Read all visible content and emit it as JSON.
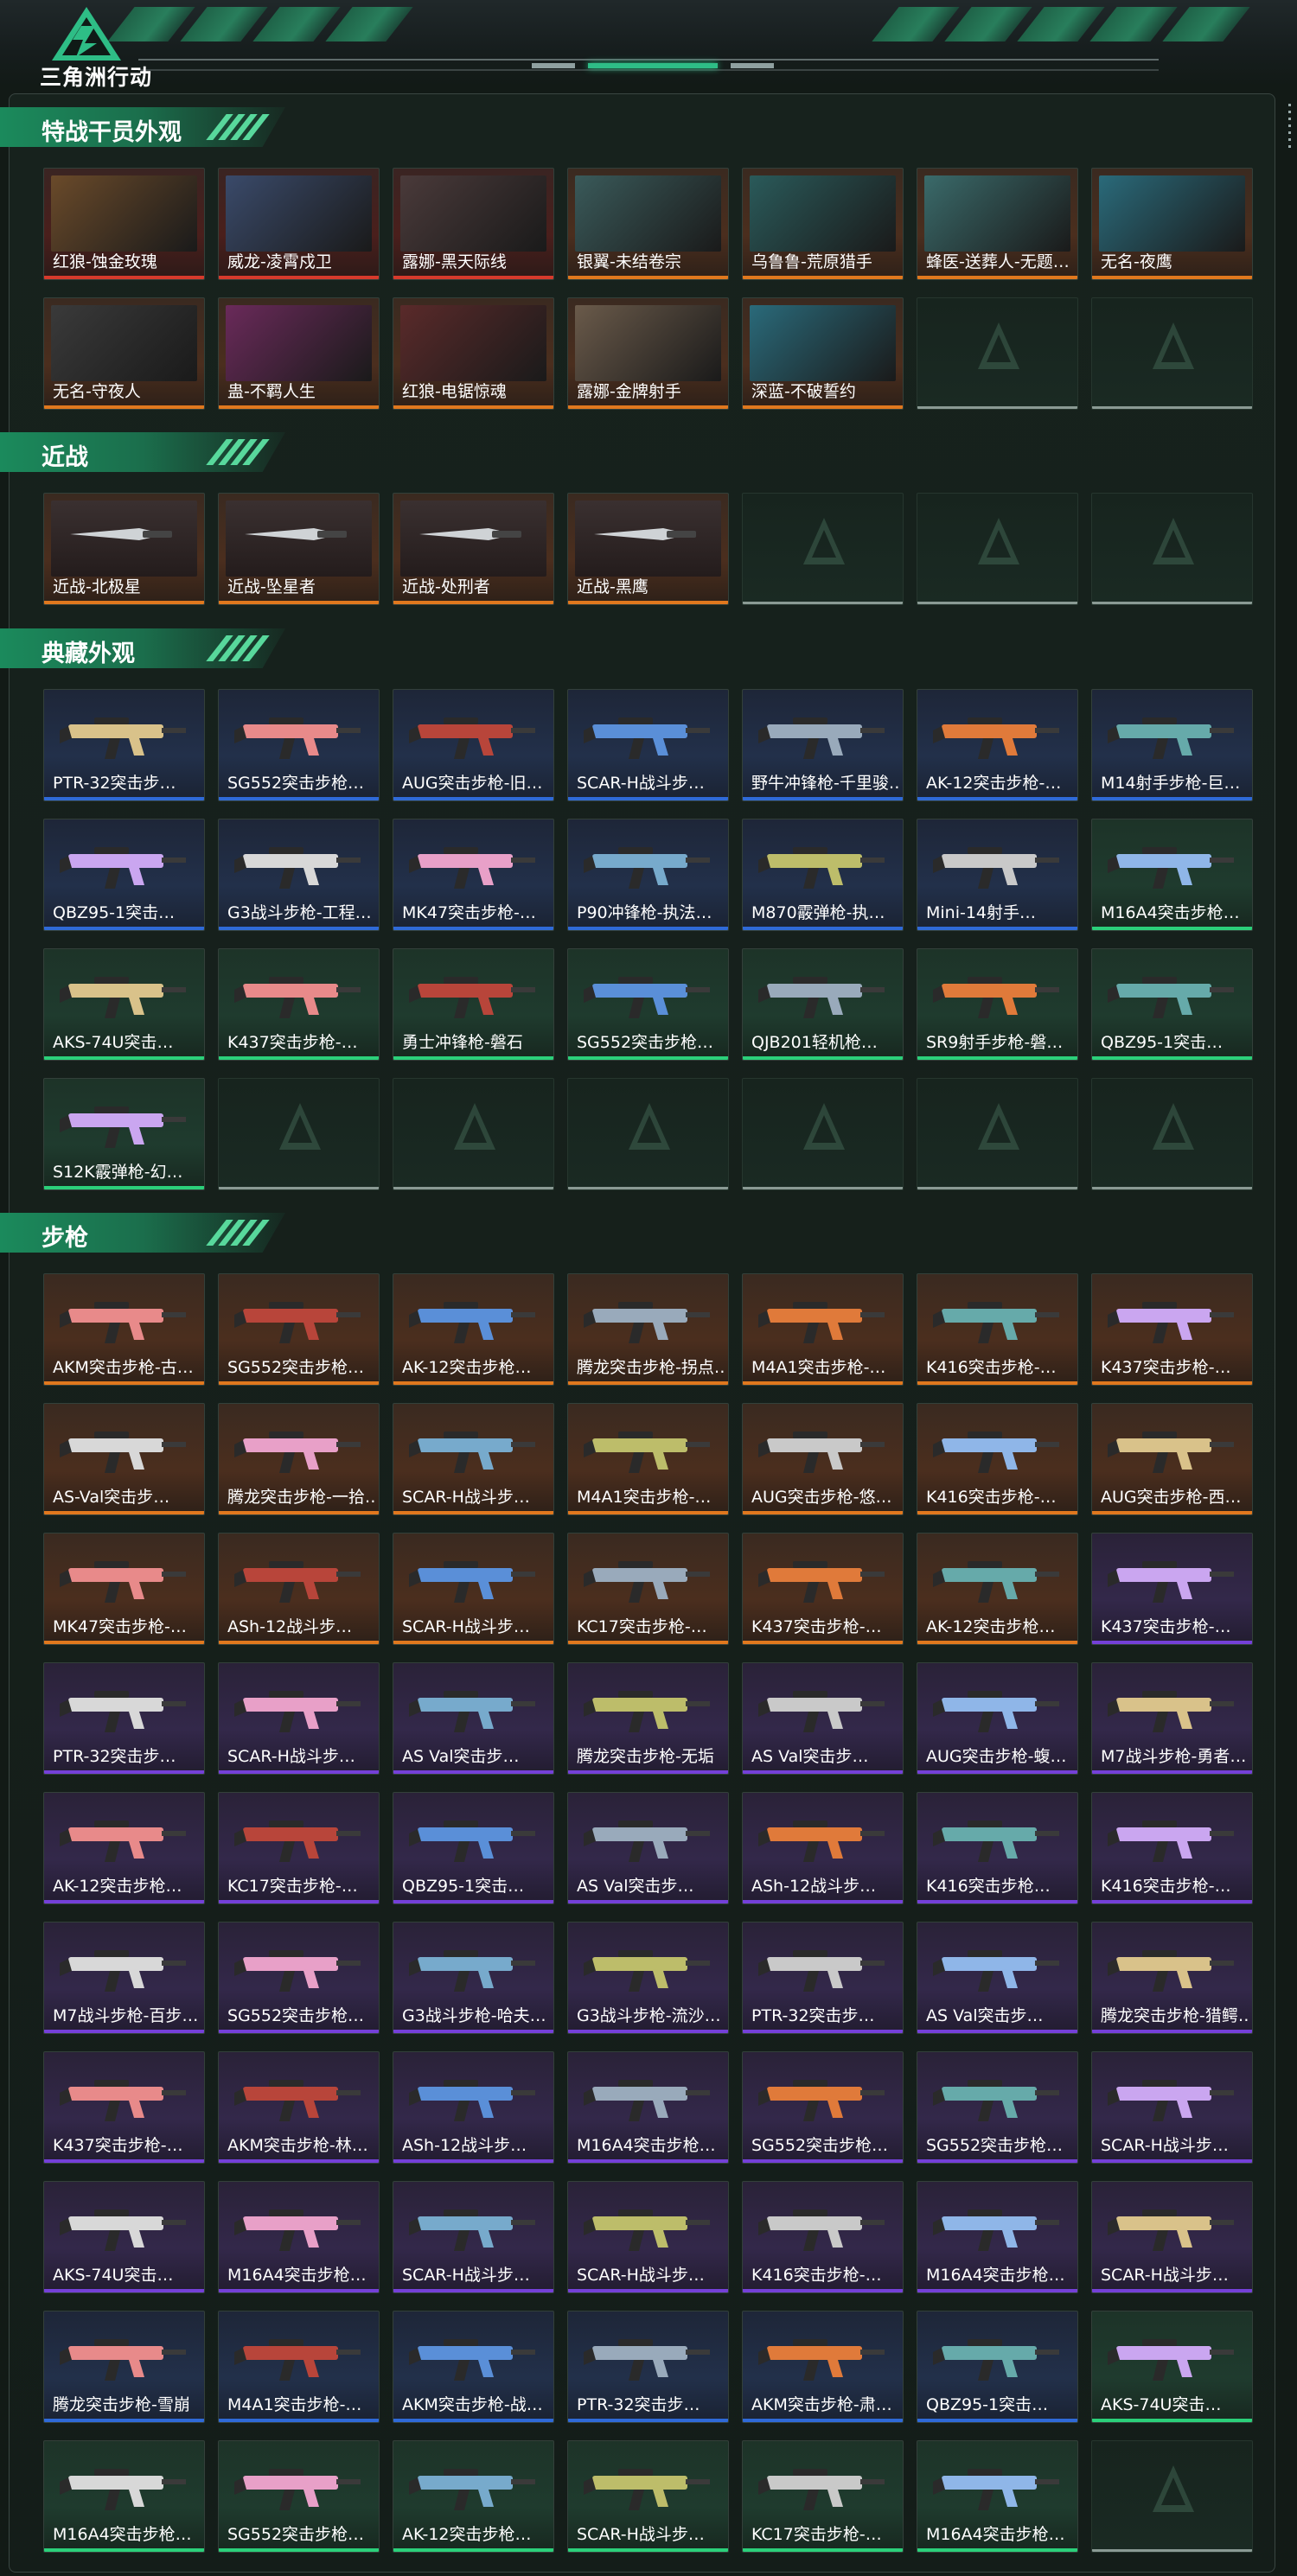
{
  "app": {
    "title": "三角洲行动"
  },
  "colors": {
    "accent": "#2ebd86",
    "rarity": {
      "red": "#d63a2c",
      "orange": "#e0781e",
      "blue": "#2f6ad8",
      "purple": "#7440d8",
      "green": "#2bd07a"
    }
  },
  "sections": [
    {
      "title": "特战干员外观",
      "items": [
        {
          "name": "红狼-蚀金玫瑰",
          "rarity": "red"
        },
        {
          "name": "威龙-凌霄戍卫",
          "rarity": "red"
        },
        {
          "name": "露娜-黑天际线",
          "rarity": "red"
        },
        {
          "name": "银翼-未结卷宗",
          "rarity": "orange"
        },
        {
          "name": "乌鲁鲁-荒原猎手",
          "rarity": "orange"
        },
        {
          "name": "蜂医-送葬人-无题…",
          "rarity": "orange"
        },
        {
          "name": "无名-夜鹰",
          "rarity": "orange"
        },
        {
          "name": "无名-守夜人",
          "rarity": "orange"
        },
        {
          "name": "蛊-不羁人生",
          "rarity": "orange"
        },
        {
          "name": "红狼-电锯惊魂",
          "rarity": "orange"
        },
        {
          "name": "露娜-金牌射手",
          "rarity": "orange"
        },
        {
          "name": "深蓝-不破誓约",
          "rarity": "orange"
        },
        {
          "empty": true
        },
        {
          "empty": true
        }
      ]
    },
    {
      "title": "近战",
      "items": [
        {
          "name": "近战-北极星",
          "rarity": "orange"
        },
        {
          "name": "近战-坠星者",
          "rarity": "orange"
        },
        {
          "name": "近战-处刑者",
          "rarity": "orange"
        },
        {
          "name": "近战-黑鹰",
          "rarity": "orange"
        },
        {
          "empty": true
        },
        {
          "empty": true
        },
        {
          "empty": true
        }
      ]
    },
    {
      "title": "典藏外观",
      "items": [
        {
          "name": "PTR-32突击步…",
          "rarity": "blue"
        },
        {
          "name": "SG552突击步枪…",
          "rarity": "blue"
        },
        {
          "name": "AUG突击步枪-旧…",
          "rarity": "blue"
        },
        {
          "name": "SCAR-H战斗步…",
          "rarity": "blue"
        },
        {
          "name": "野牛冲锋枪-千里骏…",
          "rarity": "blue"
        },
        {
          "name": "AK-12突击步枪-…",
          "rarity": "blue"
        },
        {
          "name": "M14射手步枪-巨…",
          "rarity": "blue"
        },
        {
          "name": "QBZ95-1突击…",
          "rarity": "blue"
        },
        {
          "name": "G3战斗步枪-工程…",
          "rarity": "blue"
        },
        {
          "name": "MK47突击步枪-…",
          "rarity": "blue"
        },
        {
          "name": "P90冲锋枪-执法…",
          "rarity": "blue"
        },
        {
          "name": "M870霰弹枪-执…",
          "rarity": "blue"
        },
        {
          "name": "Mini-14射手…",
          "rarity": "blue"
        },
        {
          "name": "M16A4突击步枪…",
          "rarity": "green"
        },
        {
          "name": "AKS-74U突击…",
          "rarity": "green"
        },
        {
          "name": "K437突击步枪-…",
          "rarity": "green"
        },
        {
          "name": "勇士冲锋枪-磐石",
          "rarity": "green"
        },
        {
          "name": "SG552突击步枪…",
          "rarity": "green"
        },
        {
          "name": "QJB201轻机枪…",
          "rarity": "green"
        },
        {
          "name": "SR9射手步枪-磐…",
          "rarity": "green"
        },
        {
          "name": "QBZ95-1突击…",
          "rarity": "green"
        },
        {
          "name": "S12K霰弹枪-幻…",
          "rarity": "green"
        },
        {
          "empty": true
        },
        {
          "empty": true
        },
        {
          "empty": true
        },
        {
          "empty": true
        },
        {
          "empty": true
        },
        {
          "empty": true
        }
      ]
    },
    {
      "title": "步枪",
      "items": [
        {
          "name": "AKM突击步枪-古…",
          "rarity": "orange"
        },
        {
          "name": "SG552突击步枪…",
          "rarity": "orange"
        },
        {
          "name": "AK-12突击步枪…",
          "rarity": "orange"
        },
        {
          "name": "腾龙突击步枪-拐点…",
          "rarity": "orange"
        },
        {
          "name": "M4A1突击步枪-…",
          "rarity": "orange"
        },
        {
          "name": "K416突击步枪-…",
          "rarity": "orange"
        },
        {
          "name": "K437突击步枪-…",
          "rarity": "orange"
        },
        {
          "name": "AS-Val突击步…",
          "rarity": "orange"
        },
        {
          "name": "腾龙突击步枪-一拾…",
          "rarity": "orange"
        },
        {
          "name": "SCAR-H战斗步…",
          "rarity": "orange"
        },
        {
          "name": "M4A1突击步枪-…",
          "rarity": "orange"
        },
        {
          "name": "AUG突击步枪-悠…",
          "rarity": "orange"
        },
        {
          "name": "K416突击步枪-…",
          "rarity": "orange"
        },
        {
          "name": "AUG突击步枪-西…",
          "rarity": "orange"
        },
        {
          "name": "MK47突击步枪-…",
          "rarity": "orange"
        },
        {
          "name": "ASh-12战斗步…",
          "rarity": "orange"
        },
        {
          "name": "SCAR-H战斗步…",
          "rarity": "orange"
        },
        {
          "name": "KC17突击步枪-…",
          "rarity": "orange"
        },
        {
          "name": "K437突击步枪-…",
          "rarity": "orange"
        },
        {
          "name": "AK-12突击步枪…",
          "rarity": "orange"
        },
        {
          "name": "K437突击步枪-…",
          "rarity": "purple"
        },
        {
          "name": "PTR-32突击步…",
          "rarity": "purple"
        },
        {
          "name": "SCAR-H战斗步…",
          "rarity": "purple"
        },
        {
          "name": "AS Val突击步…",
          "rarity": "purple"
        },
        {
          "name": "腾龙突击步枪-无垢",
          "rarity": "purple"
        },
        {
          "name": "AS Val突击步…",
          "rarity": "purple"
        },
        {
          "name": "AUG突击步枪-蝮…",
          "rarity": "purple"
        },
        {
          "name": "M7战斗步枪-勇者…",
          "rarity": "purple"
        },
        {
          "name": "AK-12突击步枪…",
          "rarity": "purple"
        },
        {
          "name": "KC17突击步枪-…",
          "rarity": "purple"
        },
        {
          "name": "QBZ95-1突击…",
          "rarity": "purple"
        },
        {
          "name": "AS Val突击步…",
          "rarity": "purple"
        },
        {
          "name": "ASh-12战斗步…",
          "rarity": "purple"
        },
        {
          "name": "K416突击步枪…",
          "rarity": "purple"
        },
        {
          "name": "K416突击步枪-…",
          "rarity": "purple"
        },
        {
          "name": "M7战斗步枪-百步…",
          "rarity": "purple"
        },
        {
          "name": "SG552突击步枪…",
          "rarity": "purple"
        },
        {
          "name": "G3战斗步枪-哈夫…",
          "rarity": "purple"
        },
        {
          "name": "G3战斗步枪-流沙…",
          "rarity": "purple"
        },
        {
          "name": "PTR-32突击步…",
          "rarity": "purple"
        },
        {
          "name": "AS Val突击步…",
          "rarity": "purple"
        },
        {
          "name": "腾龙突击步枪-猎鳄…",
          "rarity": "purple"
        },
        {
          "name": "K437突击步枪-…",
          "rarity": "purple"
        },
        {
          "name": "AKM突击步枪-林…",
          "rarity": "purple"
        },
        {
          "name": "ASh-12战斗步…",
          "rarity": "purple"
        },
        {
          "name": "M16A4突击步枪…",
          "rarity": "purple"
        },
        {
          "name": "SG552突击步枪…",
          "rarity": "purple"
        },
        {
          "name": "SG552突击步枪…",
          "rarity": "purple"
        },
        {
          "name": "SCAR-H战斗步…",
          "rarity": "purple"
        },
        {
          "name": "AKS-74U突击…",
          "rarity": "purple"
        },
        {
          "name": "M16A4突击步枪…",
          "rarity": "purple"
        },
        {
          "name": "SCAR-H战斗步…",
          "rarity": "purple"
        },
        {
          "name": "SCAR-H战斗步…",
          "rarity": "purple"
        },
        {
          "name": "K416突击步枪-…",
          "rarity": "purple"
        },
        {
          "name": "M16A4突击步枪…",
          "rarity": "purple"
        },
        {
          "name": "SCAR-H战斗步…",
          "rarity": "purple"
        },
        {
          "name": "腾龙突击步枪-雪崩",
          "rarity": "blue"
        },
        {
          "name": "M4A1突击步枪-…",
          "rarity": "blue"
        },
        {
          "name": "AKM突击步枪-战…",
          "rarity": "blue"
        },
        {
          "name": "PTR-32突击步…",
          "rarity": "blue"
        },
        {
          "name": "AKM突击步枪-肃…",
          "rarity": "blue"
        },
        {
          "name": "QBZ95-1突击…",
          "rarity": "blue"
        },
        {
          "name": "AKS-74U突击…",
          "rarity": "green"
        },
        {
          "name": "M16A4突击步枪…",
          "rarity": "green"
        },
        {
          "name": "SG552突击步枪…",
          "rarity": "green"
        },
        {
          "name": "AK-12突击步枪…",
          "rarity": "green"
        },
        {
          "name": "SCAR-H战斗步…",
          "rarity": "green"
        },
        {
          "name": "KC17突击步枪-…",
          "rarity": "green"
        },
        {
          "name": "M16A4突击步枪…",
          "rarity": "green"
        },
        {
          "empty": true
        }
      ]
    }
  ]
}
